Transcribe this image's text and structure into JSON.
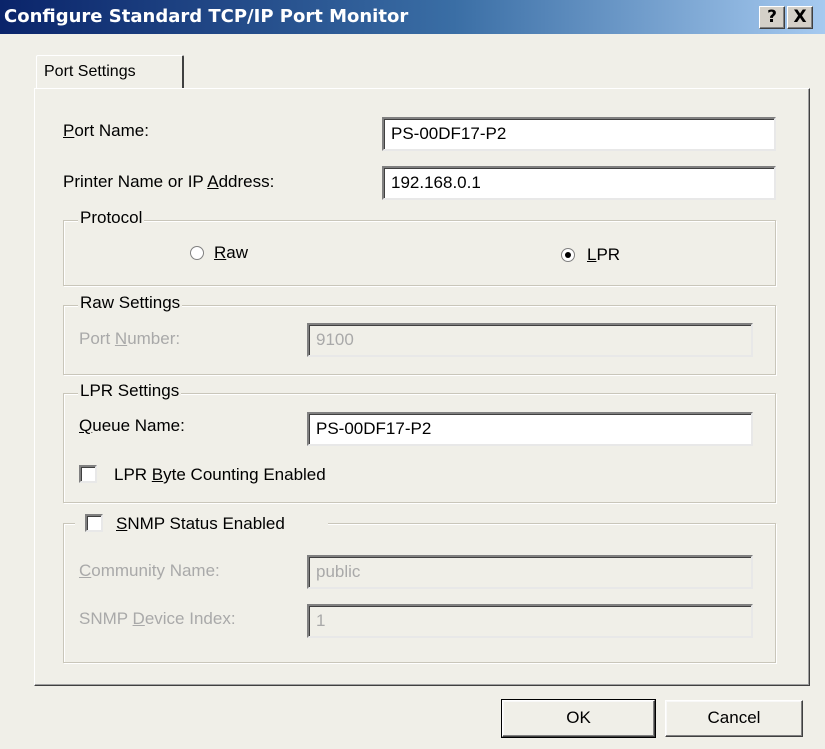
{
  "window": {
    "title": "Configure Standard TCP/IP Port Monitor",
    "help_label": "?",
    "close_label": "X"
  },
  "tabs": [
    {
      "label": "Port Settings",
      "selected": true
    }
  ],
  "port_name": {
    "label_pre": "",
    "label_u": "P",
    "label_post": "ort Name:",
    "value": "PS-00DF17-P2"
  },
  "printer_address": {
    "label_pre": "Printer Name or IP ",
    "label_u": "A",
    "label_post": "ddress:",
    "value": "192.168.0.1"
  },
  "protocol": {
    "legend": "Protocol",
    "raw": {
      "label_u": "R",
      "label_post": "aw",
      "selected": false
    },
    "lpr": {
      "label_u": "L",
      "label_post": "PR",
      "selected": true
    }
  },
  "raw_settings": {
    "legend": "Raw Settings",
    "port_number": {
      "label_pre": "Port ",
      "label_u": "N",
      "label_post": "umber:",
      "value": "9100",
      "enabled": false
    }
  },
  "lpr_settings": {
    "legend": "LPR Settings",
    "queue_name": {
      "label_u": "Q",
      "label_post": "ueue Name:",
      "value": "PS-00DF17-P2"
    },
    "byte_counting": {
      "label_pre": "LPR ",
      "label_u": "B",
      "label_post": "yte Counting Enabled",
      "checked": false
    }
  },
  "snmp": {
    "status": {
      "label_u": "S",
      "label_post": "NMP Status Enabled",
      "checked": false
    },
    "community_name": {
      "label_u": "C",
      "label_post": "ommunity Name:",
      "value": "public",
      "enabled": false
    },
    "device_index": {
      "label_pre": "SNMP ",
      "label_u": "D",
      "label_post": "evice Index:",
      "value": "1",
      "enabled": false
    }
  },
  "buttons": {
    "ok": "OK",
    "cancel": "Cancel"
  }
}
